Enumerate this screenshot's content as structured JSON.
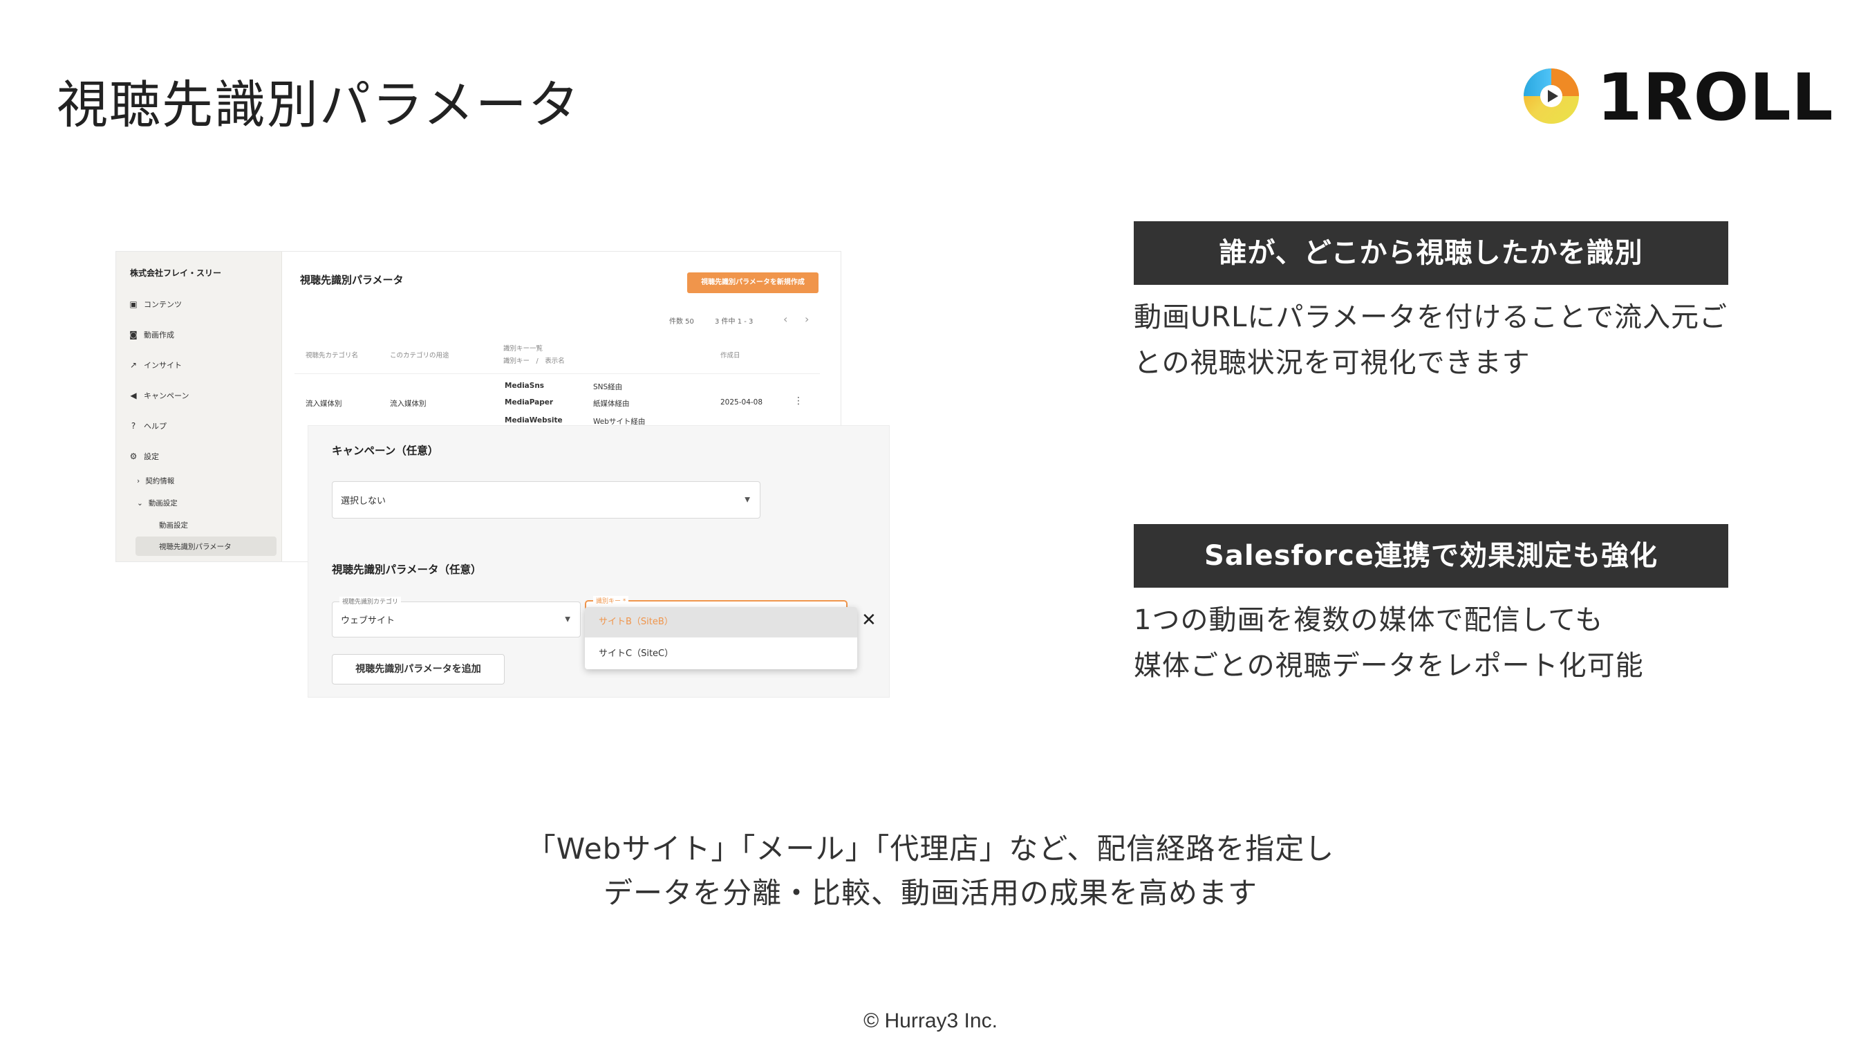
{
  "slide": {
    "title": "視聴先識別パラメータ",
    "logo_text": "1ROLL",
    "copyright": "© Hurray3 Inc."
  },
  "screenshot": {
    "sidebar": {
      "company": "株式会社フレイ・スリー",
      "items": [
        {
          "label": "コンテンツ",
          "icon": "content-icon"
        },
        {
          "label": "動画作成",
          "icon": "video-icon"
        },
        {
          "label": "インサイト",
          "icon": "insight-icon"
        },
        {
          "label": "キャンペーン",
          "icon": "campaign-icon"
        },
        {
          "label": "ヘルプ",
          "icon": "help-icon"
        },
        {
          "label": "設定",
          "icon": "gear-icon"
        }
      ],
      "sub_items": [
        "契約情報",
        "動画設定"
      ],
      "sub_sub_items": [
        "動画設定",
        "視聴先識別パラメータ"
      ]
    },
    "main": {
      "title": "視聴先識別パラメータ",
      "new_button": "視聴先識別パラメータを新規作成",
      "count_label": "件数 50",
      "range_label": "3 件中 1 - 3",
      "columns": {
        "category": "視聴先カテゴリ名",
        "usage": "このカテゴリの用途",
        "keys_line1": "識別キー一覧",
        "keys_line2": "識別キー　/　表示名",
        "created": "作成日"
      },
      "row": {
        "category": "流入媒体別",
        "usage": "流入媒体別",
        "keys": [
          {
            "key": "MediaSns",
            "name": "SNS経由"
          },
          {
            "key": "MediaPaper",
            "name": "紙媒体経由"
          },
          {
            "key": "MediaWebsite",
            "name": "Webサイト経由"
          }
        ],
        "created": "2025-04-08"
      }
    },
    "form": {
      "campaign_heading": "キャンペーン（任意）",
      "campaign_select_value": "選択しない",
      "param_heading": "視聴先識別パラメータ（任意）",
      "category_label": "視聴先識別カテゴリ",
      "category_value": "ウェブサイト",
      "key_label": "識別キー *",
      "options": [
        "サイトB（SiteB）",
        "サイトC（SiteC）"
      ],
      "add_button": "視聴先識別パラメータを追加"
    }
  },
  "features": [
    {
      "heading": "誰が、どこから視聴したかを識別",
      "lines": [
        "動画URLにパラメータを付けることで流入元ご",
        "との視聴状況を可視化できます"
      ]
    },
    {
      "heading": "Salesforce連携で効果測定も強化",
      "lines": [
        "1つの動画を複数の媒体で配信しても",
        "媒体ごとの視聴データをレポート化可能"
      ]
    }
  ],
  "summary": [
    "「Webサイト」「メール」「代理店」など、配信経路を指定し",
    "データを分離・比較、動画活用の成果を高めます"
  ],
  "colors": {
    "accent": "#f0954b",
    "feature_bar": "#333333"
  }
}
